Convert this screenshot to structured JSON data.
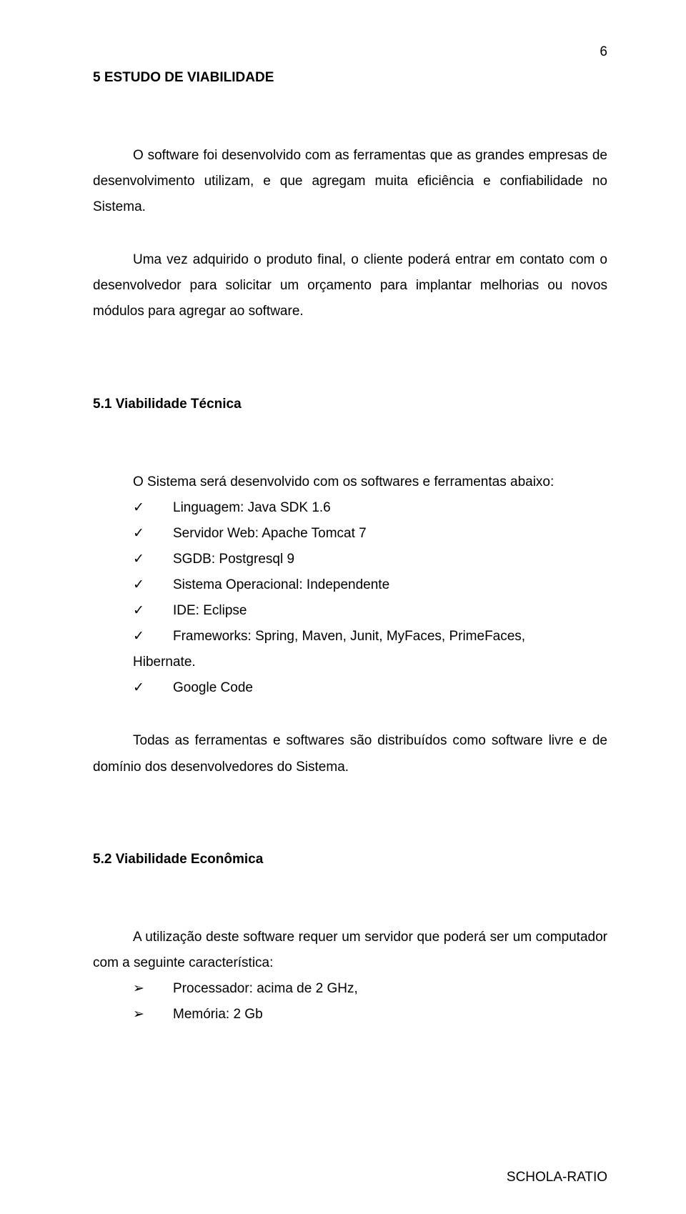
{
  "page_number": "6",
  "h1": "5    ESTUDO DE VIABILIDADE",
  "p1": "O software foi desenvolvido com as ferramentas que as grandes empresas de desenvolvimento utilizam, e que agregam muita eficiência e confiabilidade no Sistema.",
  "p2": "Uma vez adquirido o produto final, o cliente poderá entrar em contato com o desenvolvedor para solicitar um orçamento para implantar melhorias ou novos módulos para agregar ao software.",
  "h2a": "5.1   Viabilidade Técnica",
  "p3": "O Sistema será desenvolvido com os softwares e ferramentas abaixo:",
  "l1": "Linguagem: Java SDK 1.6",
  "l2": "Servidor Web: Apache Tomcat 7",
  "l3": "SGDB: Postgresql 9",
  "l4": "Sistema Operacional: Independente",
  "l5": "IDE: Eclipse",
  "l6": "Frameworks: Spring, Maven, Junit, MyFaces, PrimeFaces,",
  "l6b": "Hibernate.",
  "l7": "Google Code",
  "p4": "Todas as ferramentas e softwares são distribuídos como software livre e de domínio dos desenvolvedores do Sistema.",
  "h2b": "5.2   Viabilidade Econômica",
  "p5": "A utilização deste software requer um servidor que poderá ser um computador com a seguinte característica:",
  "l8": "Processador: acima de 2 GHz,",
  "l9": "Memória: 2 Gb",
  "footer": "SCHOLA-RATIO"
}
